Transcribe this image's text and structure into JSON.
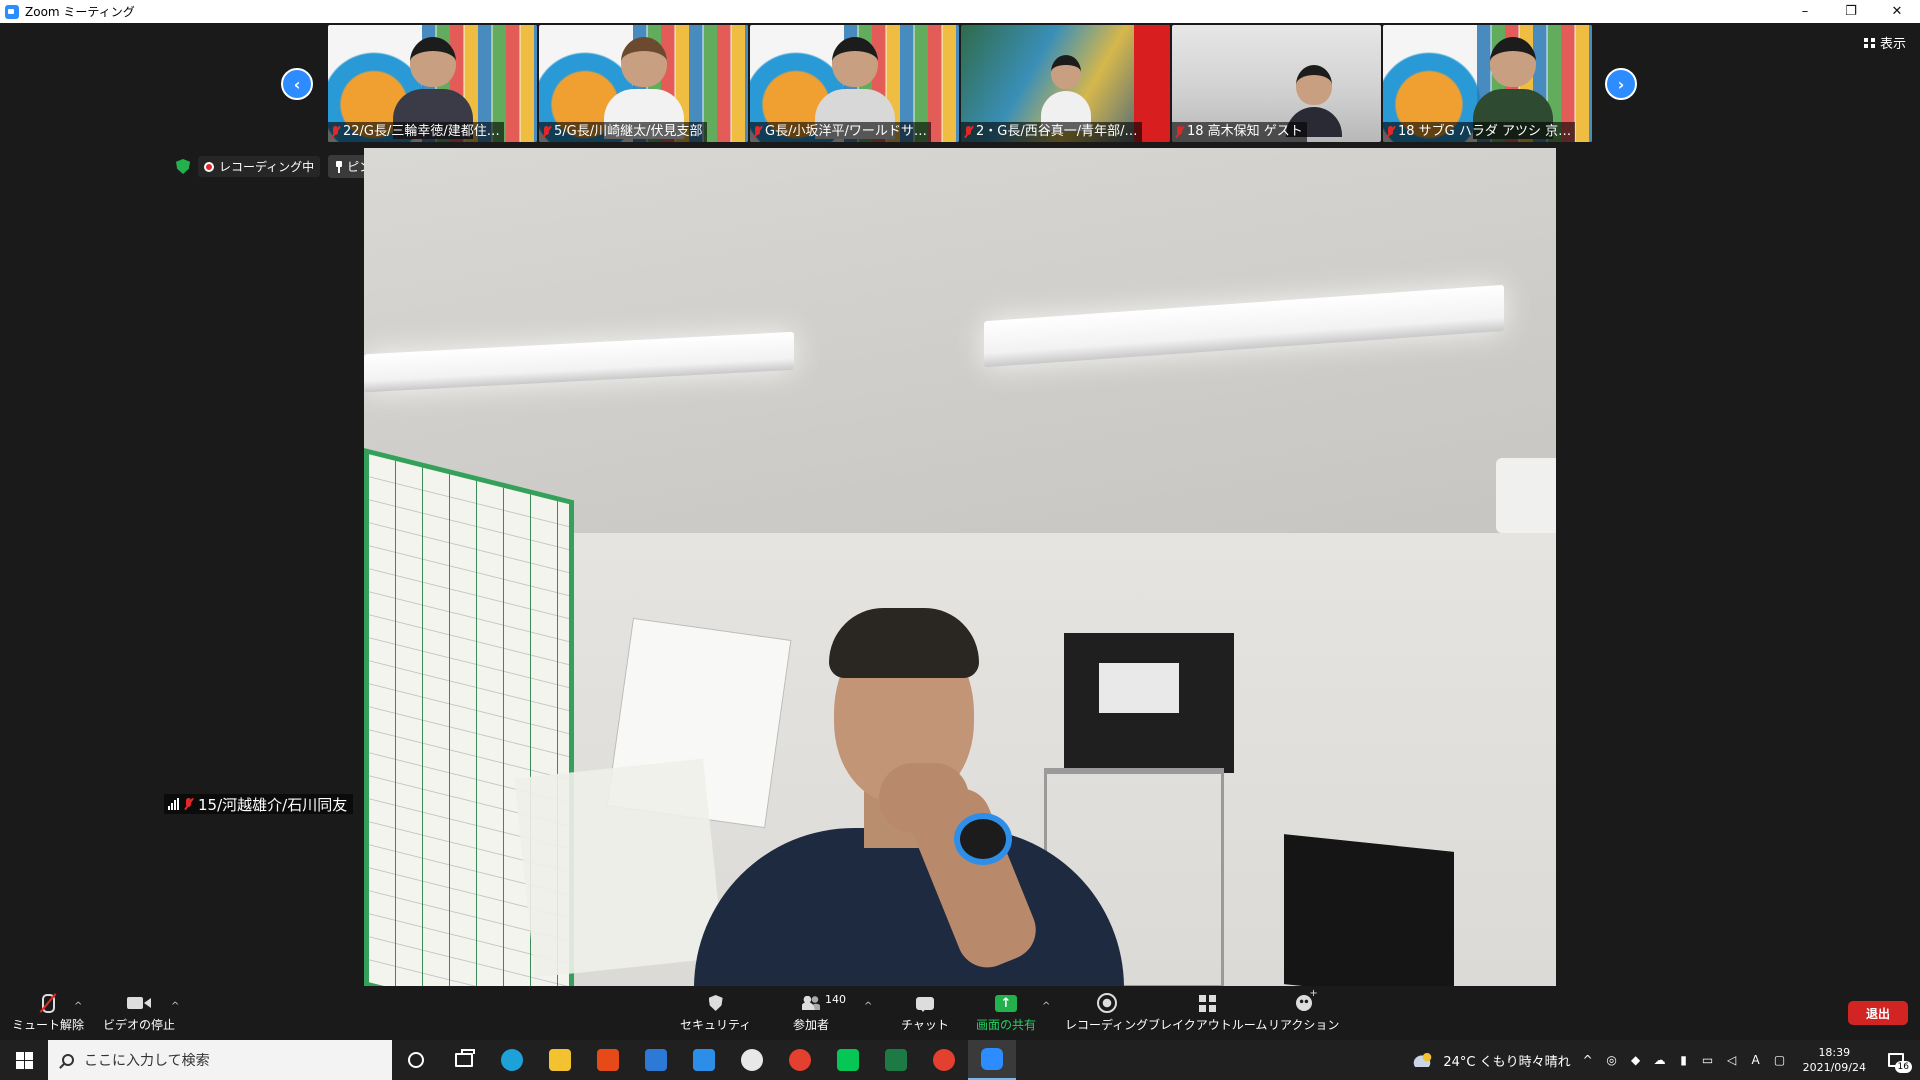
{
  "window": {
    "title": "Zoom ミーティング",
    "minimize": "–",
    "restore": "❐",
    "close": "✕"
  },
  "gallery": {
    "view_label": "表示",
    "prev_glyph": "‹",
    "next_glyph": "›",
    "participants": [
      {
        "name": "22/G長/三輪幸徳/建都住…",
        "muted": true,
        "bg": "poster"
      },
      {
        "name": "5/G長/川崎継太/伏見支部",
        "muted": true,
        "bg": "poster"
      },
      {
        "name": "G長/小坂洋平/ワールドサ…",
        "muted": true,
        "bg": "poster"
      },
      {
        "name": "2・G長/西谷真一/青年部/…",
        "muted": true,
        "bg": "peacock"
      },
      {
        "name": "18 高木保知 ゲスト",
        "muted": true,
        "bg": "office"
      },
      {
        "name": "18 サブG ハラダ アツシ 京…",
        "muted": true,
        "bg": "poster"
      }
    ]
  },
  "status": {
    "recording_label": "レコーディング中",
    "unpin_label": "ピンを削除"
  },
  "active_speaker": {
    "name": "15/河越雄介/石川同友"
  },
  "toolbar": {
    "unmute": "ミュート解除",
    "stop_video": "ビデオの停止",
    "security": "セキュリティ",
    "participants": "参加者",
    "participants_count": "140",
    "chat": "チャット",
    "share_screen": "画面の共有",
    "recording": "レコーディング",
    "breakout": "ブレイクアウトルーム",
    "reactions": "リアクション",
    "leave": "退出",
    "caret": "^"
  },
  "taskbar": {
    "search_placeholder": "ここに入力して検索",
    "weather": "24°C くもり時々晴れ",
    "ime": "A",
    "time": "18:39",
    "date": "2021/09/24",
    "notification_count": "16",
    "tray_up": "^",
    "apps": [
      {
        "name": "edge",
        "color": "#1ea1d8"
      },
      {
        "name": "explorer",
        "color": "#f2c230"
      },
      {
        "name": "office",
        "color": "#e64a19"
      },
      {
        "name": "store",
        "color": "#2d7ad6"
      },
      {
        "name": "mail",
        "color": "#2d8ee8"
      },
      {
        "name": "slack",
        "color": "#e8e8e8"
      },
      {
        "name": "chrome",
        "color": "#e4402f"
      },
      {
        "name": "line",
        "color": "#06c755"
      },
      {
        "name": "excel",
        "color": "#1d7a45"
      },
      {
        "name": "chrome-profile",
        "color": "#e4402f"
      },
      {
        "name": "zoom",
        "color": "#2d8cff"
      }
    ]
  }
}
